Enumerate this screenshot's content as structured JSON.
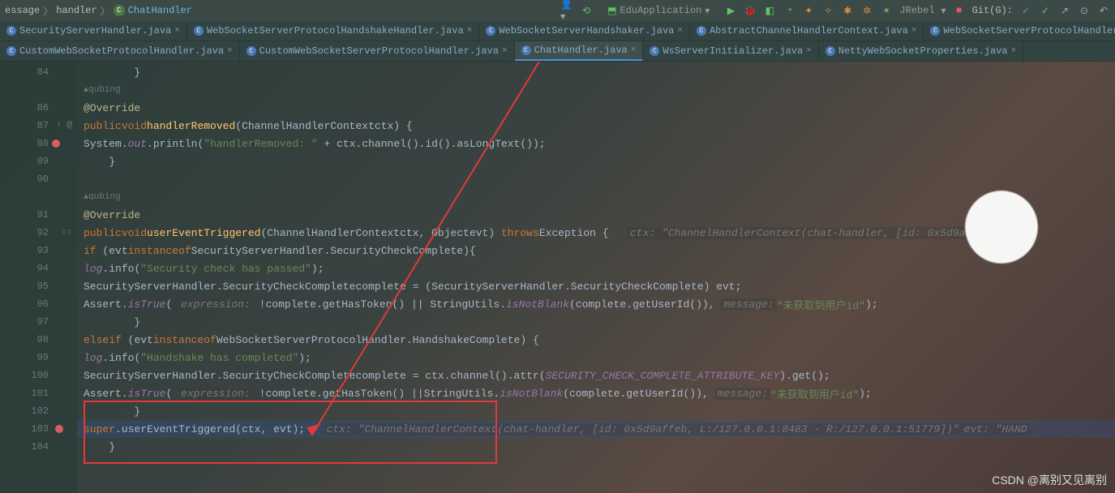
{
  "breadcrumb": {
    "path1": "essage",
    "path2": "handler",
    "class_name": "ChatHandler"
  },
  "toolbar": {
    "run_config": "EduApplication",
    "jrebel": "JRebel",
    "git_label": "Git(G):"
  },
  "tabs_row1": [
    "SecurityServerHandler.java",
    "WebSocketServerProtocolHandshakeHandler.java",
    "WebSocketServerHandshaker.java",
    "AbstractChannelHandlerContext.java",
    "WebSocketServerProtocolHandler.java"
  ],
  "tabs_row2": [
    "CustomWebSocketProtocolHandler.java",
    "CustomWebSocketServerProtocolHandler.java",
    "ChatHandler.java",
    "WsServerInitializer.java",
    "NettyWebSocketProperties.java"
  ],
  "active_tab": "ChatHandler.java",
  "lines": {
    "l84": "84",
    "l86": "86",
    "l87": "87",
    "l88": "88",
    "l89": "89",
    "l90": "90",
    "l91": "91",
    "l92": "92",
    "l93": "93",
    "l94": "94",
    "l95": "95",
    "l96": "96",
    "l97": "97",
    "l98": "98",
    "l99": "99",
    "l100": "100",
    "l101": "101",
    "l102": "102",
    "l103": "103",
    "l104": "104"
  },
  "gutter_annos": {
    "a87": "↑ @",
    "a92": "○↑"
  },
  "author": "qubing",
  "code": {
    "override": "@Override",
    "public": "public",
    "void": "void",
    "handlerRemoved": "handlerRemoved",
    "userEventTriggered": "userEventTriggered",
    "chc": "ChannelHandlerContext",
    "ctx": "ctx",
    "obj": "Object",
    "evt": "evt",
    "throws": "throws",
    "exception": "Exception",
    "sysout": "System",
    "out": "out",
    "println": "println",
    "str_hr": "\"handlerRemoved: \"",
    "channel": "channel",
    "id": "id",
    "asLongText": "asLongText",
    "if": "if",
    "else": "else",
    "instanceof": "instanceof",
    "ssh": "SecurityServerHandler",
    "scc": "SecurityCheckComplete",
    "log": "log",
    "info": "info",
    "str_sec": "\"Security check has passed\"",
    "complete": "complete",
    "new_": "=",
    "cast_open": "(",
    "cast_close": ")",
    "assert": "Assert",
    "isTrue": "isTrue",
    "expr_hint": "expression:",
    "getHasToken": "getHasToken",
    "su": "StringUtils",
    "isNotBlank": "isNotBlank",
    "getUserId": "getUserId",
    "msg_hint": "message:",
    "str_err": "\"未获取到用户id\"",
    "wssph": "WebSocketServerProtocolHandler",
    "hc": "HandshakeComplete",
    "str_hs": "\"Handshake has completed\"",
    "attr": "attr",
    "attrkey": "SECURITY_CHECK_COMPLETE_ATTRIBUTE_KEY",
    "get": "get",
    "super": "super",
    "ctx_hint": "ctx:",
    "evt_hint": "evt:",
    "inline_92": "\"ChannelHandlerContext(chat-handler, [id: 0x5d9affeb, L:/12",
    "inline_103": "\"ChannelHandlerContext(chat-handler, [id: 0x5d9affeb, L:/127.0.0.1:8483 - R:/127.0.0.1:51779])\"",
    "inline_103b": "\"HAND"
  },
  "watermark": "CSDN @离别又见离别"
}
